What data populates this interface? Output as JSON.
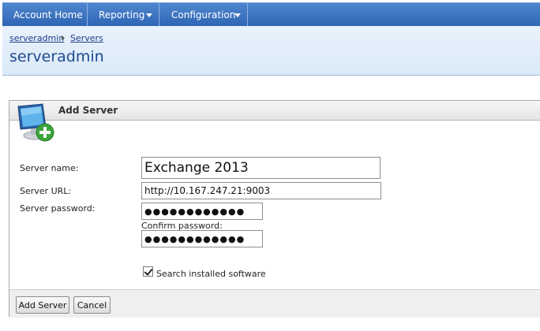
{
  "nav": {
    "items": [
      {
        "label": "Account Home"
      },
      {
        "label": "Reporting"
      },
      {
        "label": "Configuration"
      }
    ]
  },
  "breadcrumb": {
    "items": [
      "serveradmin",
      "Servers"
    ]
  },
  "page": {
    "title": "serveradmin"
  },
  "panel": {
    "title": "Add Server",
    "icon": "computer-add-icon"
  },
  "form": {
    "server_name_label": "Server name:",
    "server_name_value": "Exchange 2013",
    "server_url_label": "Server URL:",
    "server_url_value": "http://10.167.247.21:9003",
    "server_password_label": "Server password:",
    "server_password_value": "●●●●●●●●●●●●",
    "confirm_password_label": "Confirm password:",
    "confirm_password_value": "●●●●●●●●●●●●",
    "search_software_label": "Search installed software",
    "search_software_checked": true
  },
  "buttons": {
    "add": "Add Server",
    "cancel": "Cancel"
  },
  "colors": {
    "nav": "#2f66b4",
    "title": "#1d4a8f",
    "header_bg": "#e2eefa"
  }
}
